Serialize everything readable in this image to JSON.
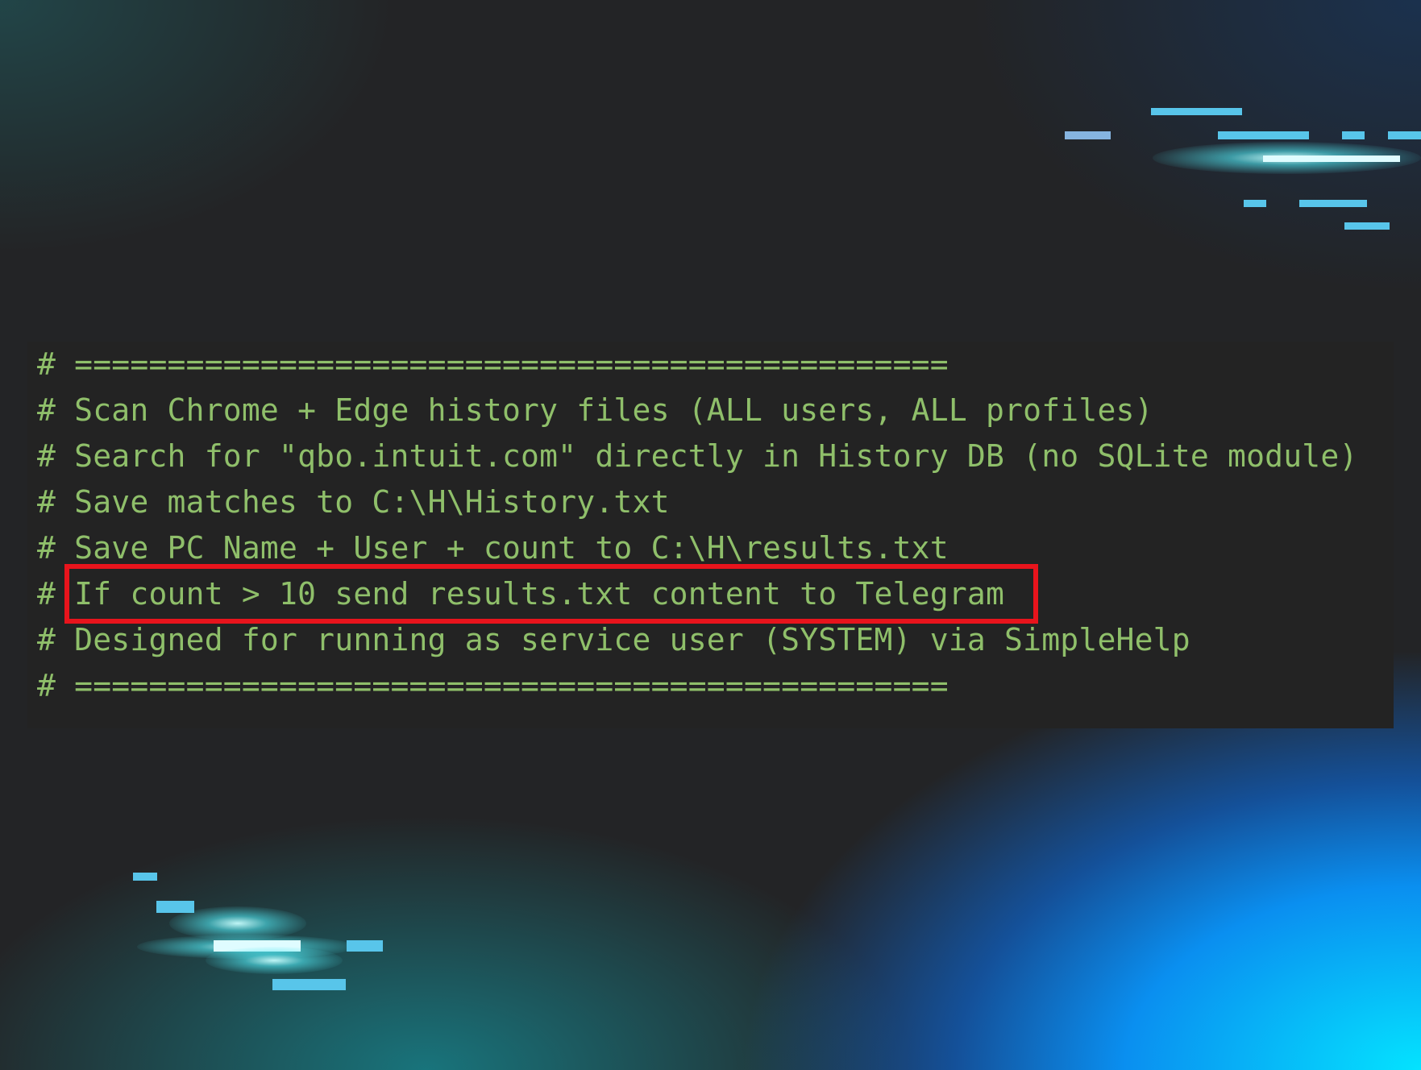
{
  "code_panel": {
    "lines": [
      "# ===============================================",
      "# Scan Chrome + Edge history files (ALL users, ALL profiles)",
      "# Search for \"qbo.intuit.com\" directly in History DB (no SQLite module)",
      "# Save matches to C:\\H\\History.txt",
      "# Save PC Name + User + count to C:\\H\\results.txt",
      "# If count > 10 send results.txt content to Telegram",
      "# Designed for running as service user (SYSTEM) via SimpleHelp",
      "# ==============================================="
    ],
    "highlighted_line_index": 5
  },
  "colors": {
    "comment_text": "#8fbf6a",
    "highlight_border": "#e8141c",
    "panel_background": "#232323",
    "accent_streak": "#58c5ea"
  }
}
